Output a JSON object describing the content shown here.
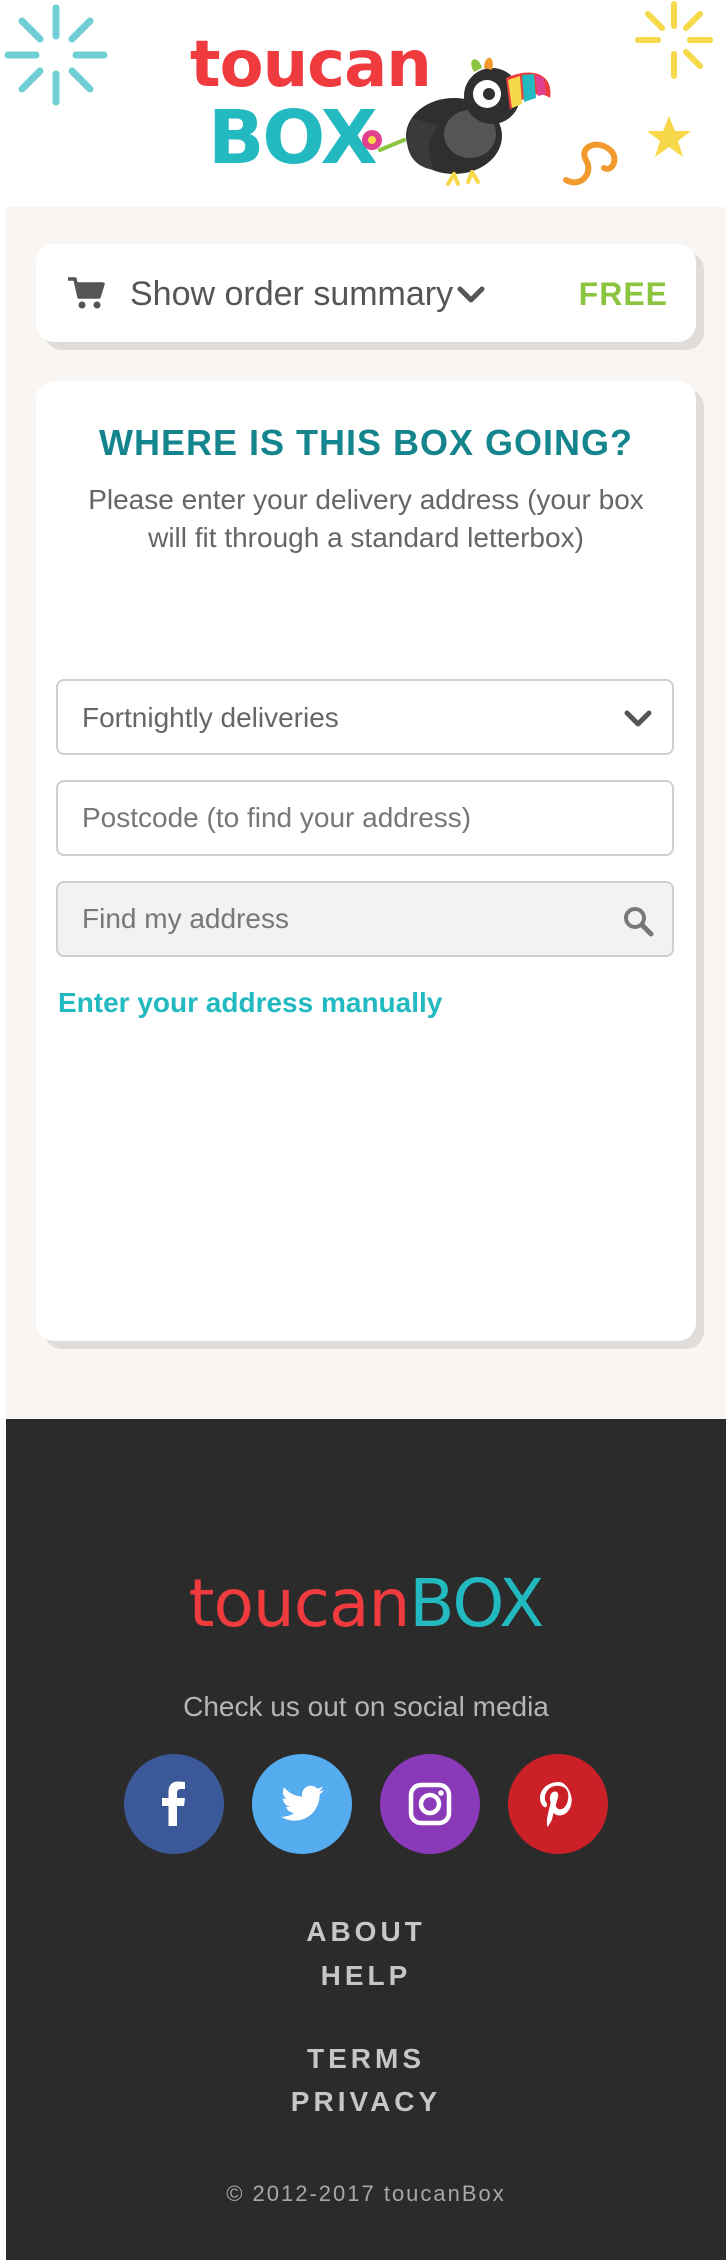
{
  "brand": {
    "logo_word_top": "toucan",
    "logo_word_bottom": "BOX",
    "registered_mark": "®",
    "colors": {
      "red": "#ef3b3e",
      "teal": "#23b9c0",
      "green": "#8bc53f",
      "dark_teal": "#14848d"
    }
  },
  "order_summary": {
    "icon": "cart-icon",
    "label": "Show order summary",
    "chevron_icon": "chevron-down-icon",
    "price": "FREE"
  },
  "address": {
    "title": "WHERE IS THIS BOX GOING?",
    "subtitle": "Please enter your delivery address (your box will fit through a standard letterbox)",
    "frequency": {
      "selected": "Fortnightly deliveries",
      "icon": "chevron-down-icon"
    },
    "postcode": {
      "placeholder": "Postcode (to find your address)",
      "value": ""
    },
    "find": {
      "placeholder": "Find my address",
      "value": "",
      "icon": "search-icon"
    },
    "manual_link": "Enter your address manually"
  },
  "footer": {
    "logo_word_left": "toucan",
    "logo_word_right": "BOX",
    "social_caption": "Check us out on social media",
    "social": [
      {
        "name": "facebook",
        "icon": "facebook-icon",
        "color": "#3b5998"
      },
      {
        "name": "twitter",
        "icon": "twitter-icon",
        "color": "#55acee"
      },
      {
        "name": "instagram",
        "icon": "instagram-icon",
        "color": "#8a3ab9"
      },
      {
        "name": "pinterest",
        "icon": "pinterest-icon",
        "color": "#cb2027"
      }
    ],
    "links": {
      "about": "ABOUT",
      "help": "HELP",
      "terms": "TERMS",
      "privacy": "PRIVACY"
    },
    "copyright": "© 2012-2017 toucanBox"
  }
}
